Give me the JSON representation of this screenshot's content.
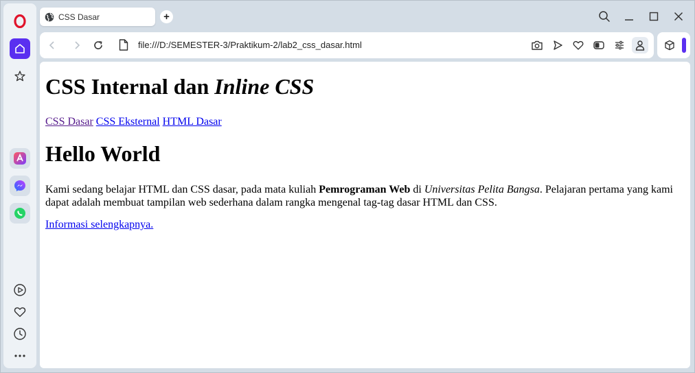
{
  "tab": {
    "title": "CSS Dasar",
    "globe_icon": "globe-icon"
  },
  "address": {
    "url": "file:///D:/SEMESTER-3/Praktikum-2/lab2_css_dasar.html"
  },
  "colors": {
    "accent": "#5a2ff0",
    "link": "#0000ee",
    "visited_link": "#551a8b",
    "chrome": "#d4dde6"
  },
  "sidebar": {
    "items": [
      {
        "name": "opera-logo",
        "icon": "opera-icon"
      },
      {
        "name": "home",
        "icon": "home-icon"
      },
      {
        "name": "bookmarks",
        "icon": "star-icon"
      },
      {
        "name": "aria",
        "icon": "aria-icon"
      },
      {
        "name": "messenger",
        "icon": "messenger-icon"
      },
      {
        "name": "whatsapp",
        "icon": "whatsapp-icon"
      },
      {
        "name": "player",
        "icon": "play-icon"
      },
      {
        "name": "favorites",
        "icon": "heart-icon"
      },
      {
        "name": "history",
        "icon": "clock-icon"
      },
      {
        "name": "more",
        "icon": "more-icon"
      }
    ]
  },
  "page": {
    "title_regular": "CSS Internal dan ",
    "title_italic": "Inline CSS",
    "links": [
      {
        "label": "CSS Dasar"
      },
      {
        "label": "CSS Eksternal"
      },
      {
        "label": "HTML Dasar"
      }
    ],
    "heading": "Hello World",
    "para": {
      "part1": "Kami sedang belajar HTML dan CSS dasar, pada mata kuliah ",
      "bold": "Pemrograman Web",
      "part2": " di ",
      "italic": "Universitas Pelita Bangsa",
      "part3": ". Pelajaran pertama yang kami dapat adalah membuat tampilan web sederhana dalam rangka mengenal tag-tag dasar HTML dan CSS."
    },
    "more_link": "Informasi selengkapnya."
  }
}
